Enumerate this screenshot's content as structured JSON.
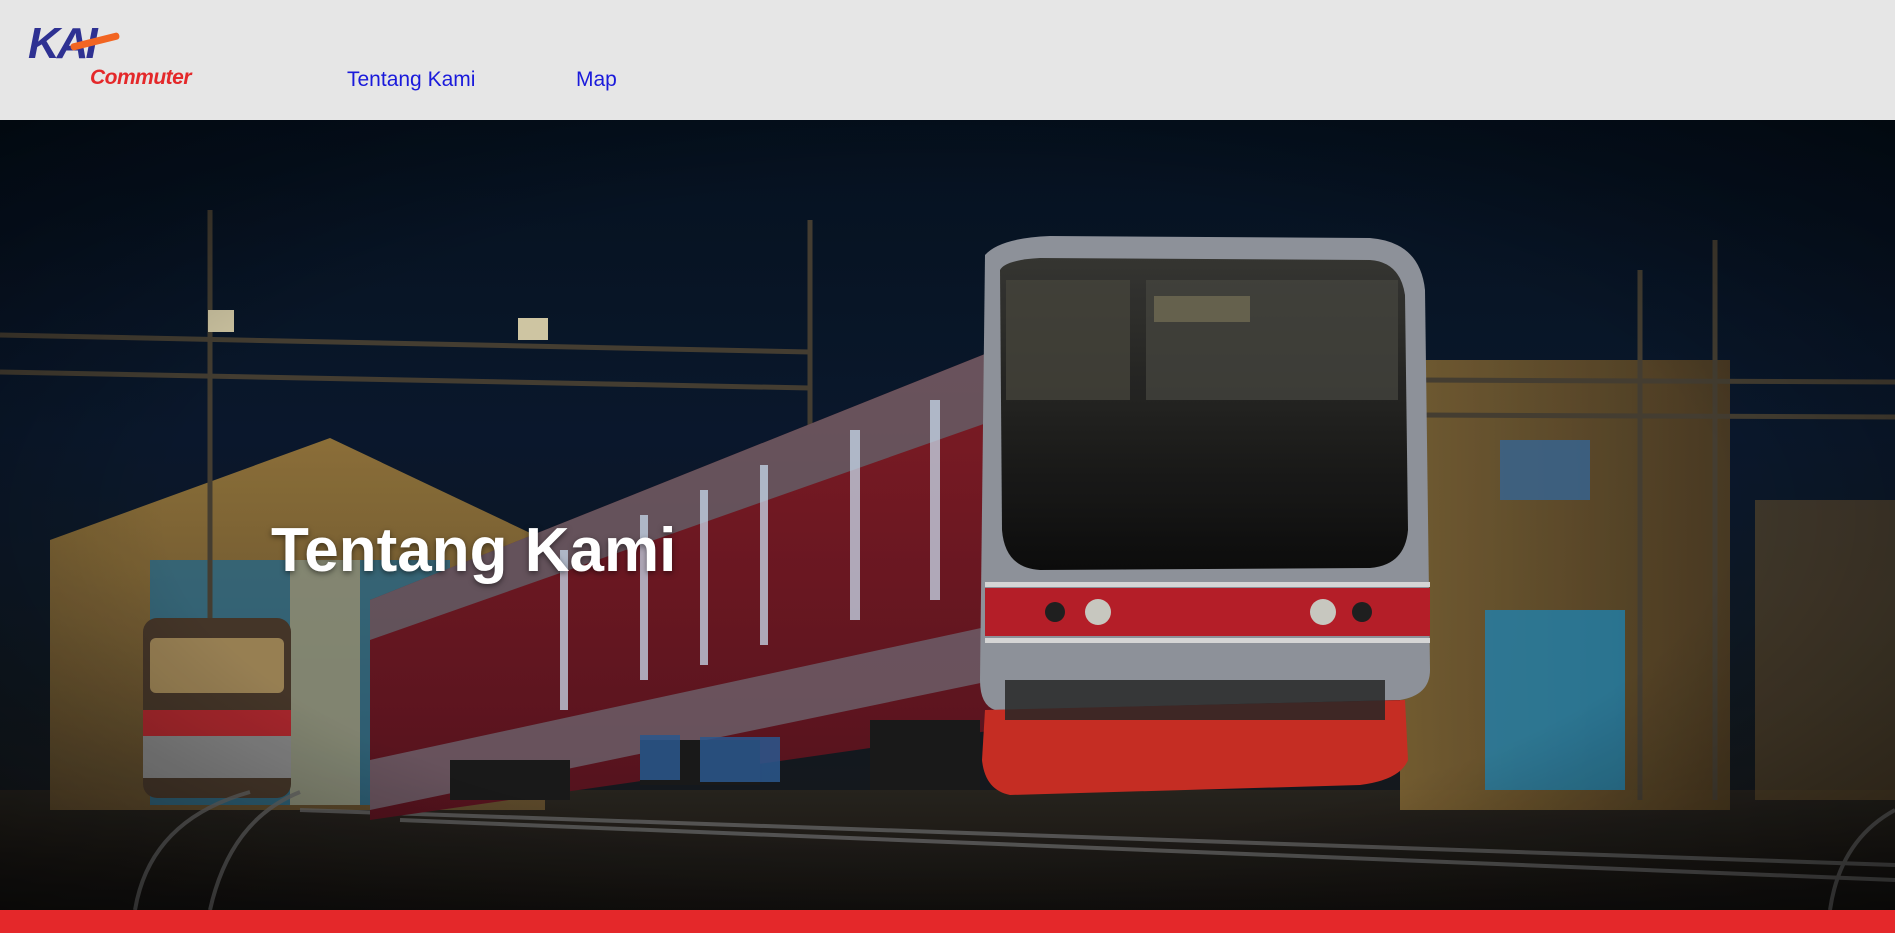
{
  "brand": {
    "logo_main": "KAI",
    "logo_sub": "Commuter",
    "colors": {
      "navy": "#2e3192",
      "red": "#e4282a",
      "orange": "#f26522"
    }
  },
  "nav": {
    "items": [
      {
        "label": "Tentang Kami"
      },
      {
        "label": "Map"
      }
    ],
    "link_color": "#1a1adb"
  },
  "hero": {
    "title": "Tentang Kami",
    "image": "night-commuter-train-depot"
  },
  "footer": {
    "accent_color": "#e4282a"
  }
}
